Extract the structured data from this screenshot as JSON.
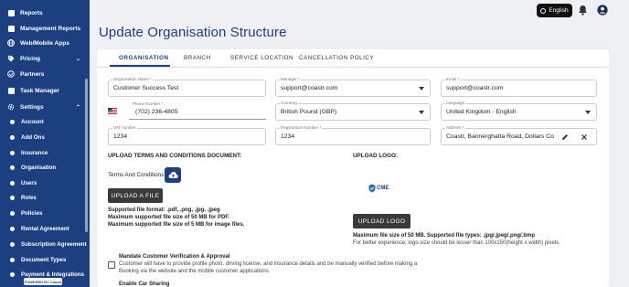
{
  "sidebar": {
    "items": [
      {
        "label": "Reports"
      },
      {
        "label": "Management Reports"
      },
      {
        "label": "Web/Mobile Apps"
      },
      {
        "label": "Pricing",
        "chevron": "chevron-down"
      },
      {
        "label": "Partners"
      },
      {
        "label": "Task Manager"
      },
      {
        "label": "Settings",
        "chevron": "chevron-up"
      }
    ],
    "sub_items": [
      {
        "label": "Account"
      },
      {
        "label": "Add Ons"
      },
      {
        "label": "Insurance"
      },
      {
        "label": "Organisation"
      },
      {
        "label": "Users"
      },
      {
        "label": "Roles"
      },
      {
        "label": "Policies"
      },
      {
        "label": "Rental Agreement"
      },
      {
        "label": "Subscription Agreement"
      },
      {
        "label": "Document Types"
      },
      {
        "label": "Payment & Integrations"
      }
    ],
    "powered_by": "POWERED BY Coastr"
  },
  "header": {
    "language": "English",
    "bell_icon": "bell-icon",
    "user_icon": "user-icon"
  },
  "page": {
    "title": "Update Organisation Structure"
  },
  "tabs": [
    {
      "label": "ORGANISATION",
      "active": true
    },
    {
      "label": "BRANCH"
    },
    {
      "label": "SERVICE LOCATION"
    },
    {
      "label": "CANCELLATION POLICY"
    }
  ],
  "form": {
    "org_name": {
      "label": "Organisation Name *",
      "value": "Customer Success Test"
    },
    "manager": {
      "label": "Manager *",
      "value": "support@coastr.com"
    },
    "email": {
      "label": "Email *",
      "value": "support@coastr.com"
    },
    "phone": {
      "label": "Phone Number *",
      "value": "(702) 236-4805"
    },
    "currency": {
      "label": "Currency",
      "value": "British Pound (GBP)"
    },
    "language": {
      "label": "Language",
      "value": "United Kingdom - English"
    },
    "vat": {
      "label": "VAT number",
      "value": "1234"
    },
    "registration": {
      "label": "Registration Number *",
      "value": "1234"
    },
    "address": {
      "label": "Address *",
      "value": "Coastr, Bannerghatta Road, Dollars Colon"
    }
  },
  "upload_terms": {
    "heading": "UPLOAD TERMS AND CONDITIONS DOCUMENT:",
    "label": "Terms And Conditions",
    "button": "UPLOAD A FILE",
    "info1": "Supported file format: .pdf, .png, .jpg, .jpeg",
    "info2": "Maximum supported file size of 50 MB for PDF.",
    "info3": "Maximum supported file size of 5 MB for image files."
  },
  "upload_logo": {
    "heading": "UPLOAD LOGO:",
    "logo_text": "CME",
    "button": "UPLOAD LOGO",
    "info1": "Maximum file size of 50 MB. Supported file types: .jpg/.jpeg/.png/.bmp",
    "info2": "For better experience, logo size should be lesser than 100x150(height x width) pixels."
  },
  "verification": {
    "title": "Mandate Customer Verification & Approval",
    "desc1": "Customer will have to provide profile photo, driving license, and insurance details and be manually verified before making a",
    "desc2": "Booking via the website and the mobile customer applications.",
    "next_title": "Enable Car Sharing"
  },
  "colors": {
    "brand": "#1c3f80",
    "dark_button": "#3a3a3a"
  }
}
